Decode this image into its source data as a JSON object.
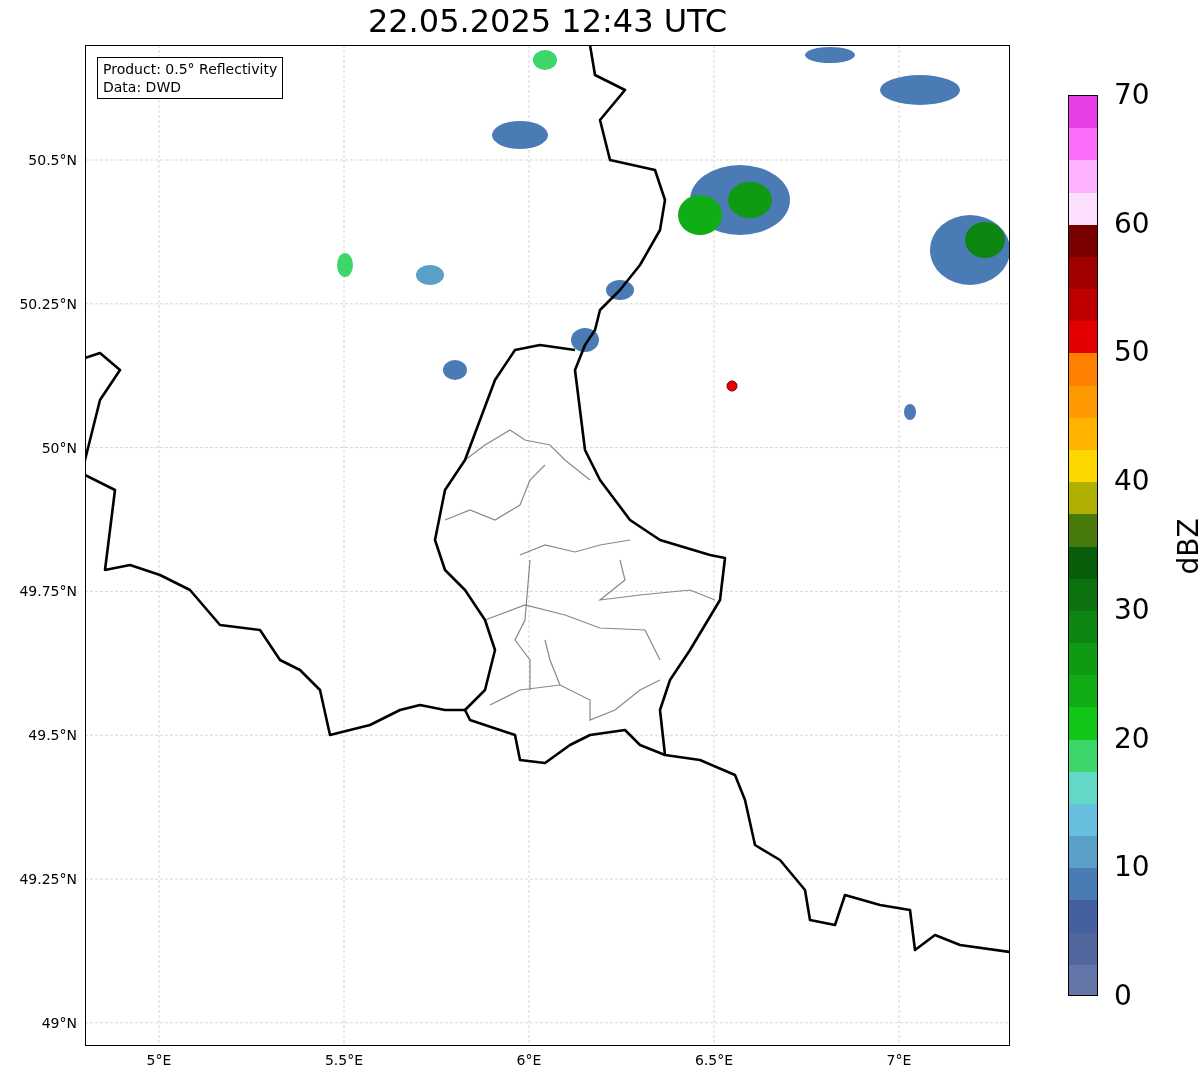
{
  "title": "22.05.2025 12:43 UTC",
  "info_box": {
    "lines": [
      "Product: 0.5° Reflectivity",
      "Data: DWD"
    ]
  },
  "map": {
    "x_ticks": [
      "5°E",
      "5.5°E",
      "6°E",
      "6.5°E",
      "7°E"
    ],
    "y_ticks": [
      "50.5°N",
      "50.25°N",
      "50°N",
      "49.75°N",
      "49.5°N",
      "49.25°N",
      "49°N"
    ]
  },
  "colorbar": {
    "label": "dBZ",
    "ticks": [
      "70",
      "60",
      "50",
      "40",
      "30",
      "20",
      "10",
      "0"
    ],
    "segments": [
      {
        "color": "#e83ee8"
      },
      {
        "color": "#fb6cfb"
      },
      {
        "color": "#fdb2fd"
      },
      {
        "color": "#fde0fd"
      },
      {
        "color": "#7a0000"
      },
      {
        "color": "#a00000"
      },
      {
        "color": "#c00000"
      },
      {
        "color": "#e30000"
      },
      {
        "color": "#ff7f00"
      },
      {
        "color": "#ff9900"
      },
      {
        "color": "#ffb300"
      },
      {
        "color": "#ffd700"
      },
      {
        "color": "#b0b000"
      },
      {
        "color": "#477a0a"
      },
      {
        "color": "#085d0b"
      },
      {
        "color": "#0c7210"
      },
      {
        "color": "#0d8611"
      },
      {
        "color": "#0e9a13"
      },
      {
        "color": "#10ad16"
      },
      {
        "color": "#12c718"
      },
      {
        "color": "#3dd66b"
      },
      {
        "color": "#62d8c6"
      },
      {
        "color": "#66c0dd"
      },
      {
        "color": "#5a9fc8"
      },
      {
        "color": "#4a7bb5"
      },
      {
        "color": "#4560a0"
      },
      {
        "color": "#53679f"
      },
      {
        "color": "#6476a8"
      }
    ]
  }
}
